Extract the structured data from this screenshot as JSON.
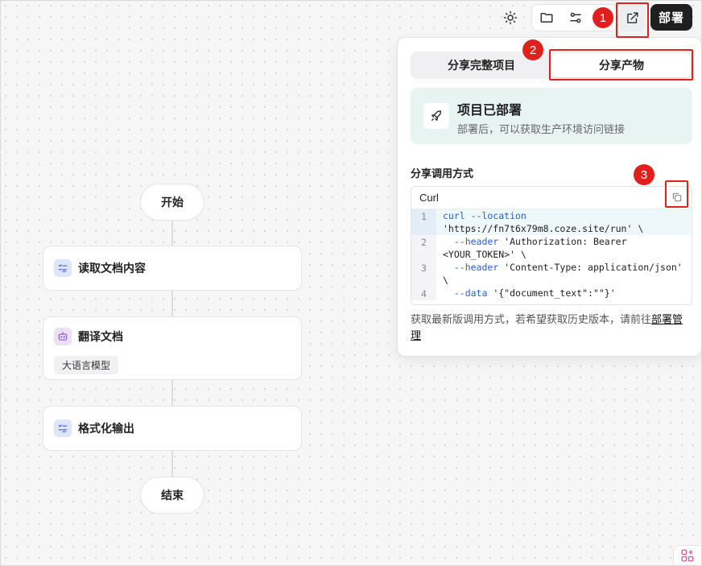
{
  "toolbar": {
    "theme_icon": "sun-icon",
    "folder_icon": "folder-icon",
    "settings_icon": "sliders-icon",
    "share_icon": "external-share-icon",
    "deploy_label": "部署"
  },
  "annotations": [
    "1",
    "2",
    "3"
  ],
  "workflow": {
    "start_label": "开始",
    "end_label": "结束",
    "nodes": [
      {
        "title": "读取文档内容",
        "icon": "code-icon"
      },
      {
        "title": "翻译文档",
        "icon": "robot-icon",
        "tag": "大语言模型"
      },
      {
        "title": "格式化输出",
        "icon": "code-icon"
      }
    ]
  },
  "share_panel": {
    "tabs": [
      "分享完整项目",
      "分享产物"
    ],
    "active_tab": "分享产物",
    "deployed_title": "项目已部署",
    "deployed_subtitle": "部署后，可以获取生产环境访问链接",
    "section_title": "分享调用方式",
    "code_lang": "Curl",
    "code_lines": [
      {
        "num": "1",
        "text": "curl --location 'https://fn7t6x79m8.coze.site/run' \\"
      },
      {
        "num": "2",
        "text": "  --header 'Authorization: Bearer <YOUR_TOKEN>' \\"
      },
      {
        "num": "3",
        "text": "  --header 'Content-Type: application/json' \\"
      },
      {
        "num": "4",
        "text": "  --data '{\"document_text\":\"\"}'"
      }
    ],
    "footer_text": "获取最新版调用方式，若希望获取历史版本，请前往",
    "footer_link": "部署管理"
  },
  "colors": {
    "accent_red": "#e0201d",
    "deploy_bg": "#1f1f1f",
    "deployed_card_bg": "#e8f4f1"
  }
}
